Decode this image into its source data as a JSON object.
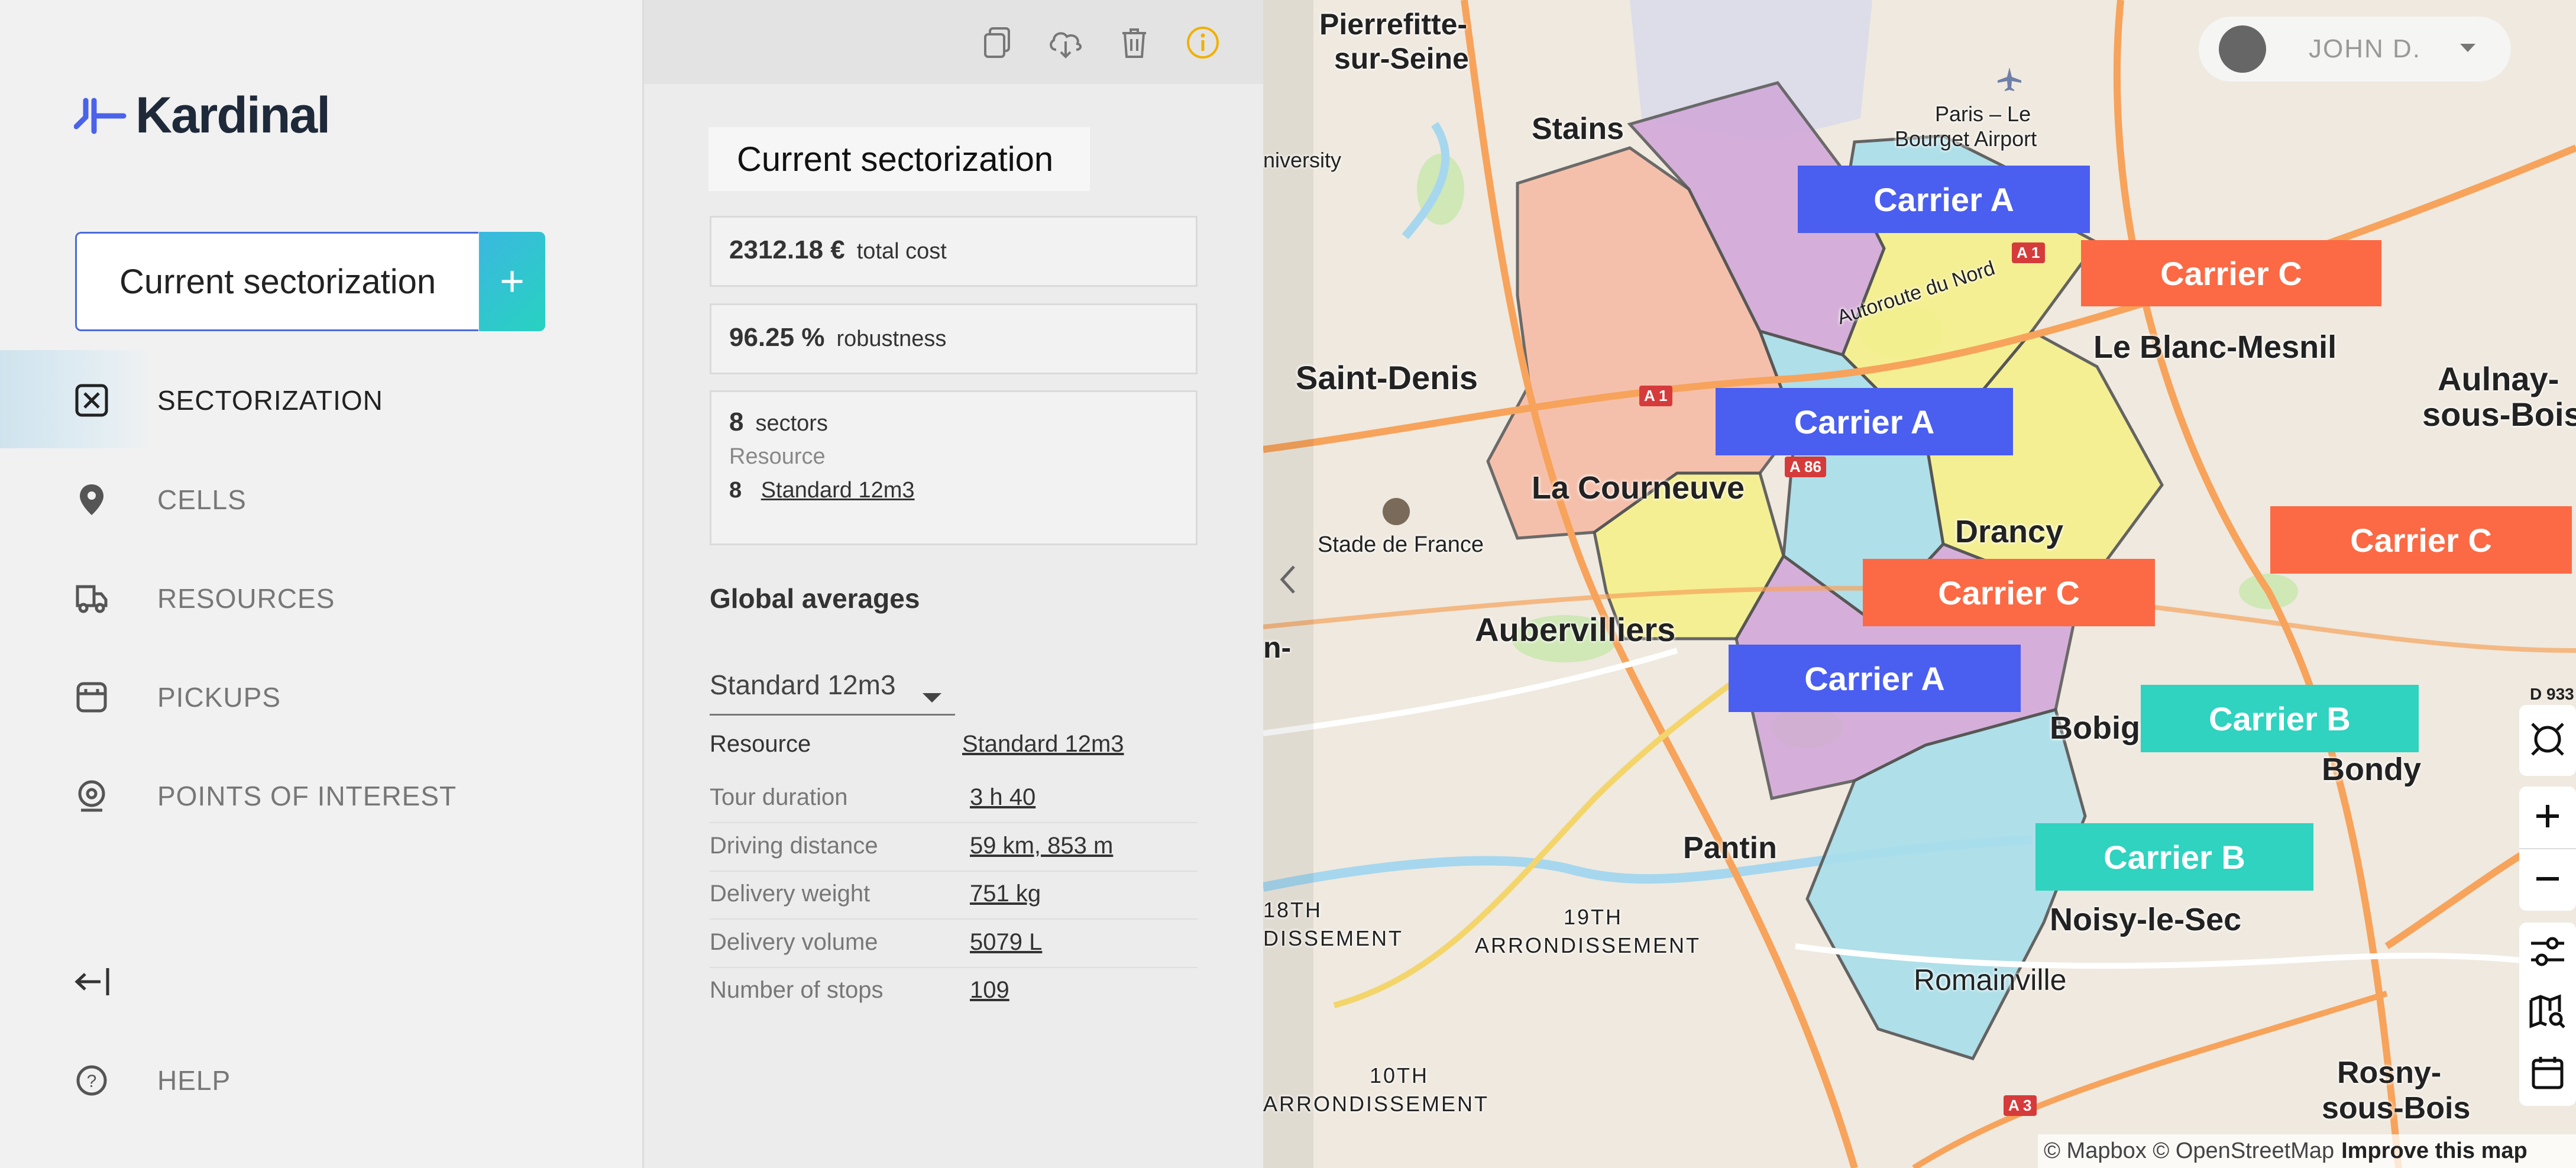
{
  "app": {
    "brand": "Kardinal"
  },
  "sidebar": {
    "sectorization_select": "Current sectorization",
    "add_label": "+",
    "items": [
      {
        "label": "SECTORIZATION",
        "icon": "sectorization-icon",
        "active": true
      },
      {
        "label": "CELLS",
        "icon": "location-pin-icon"
      },
      {
        "label": "RESOURCES",
        "icon": "truck-icon"
      },
      {
        "label": "PICKUPS",
        "icon": "pickup-box-icon"
      },
      {
        "label": "POINTS OF INTEREST",
        "icon": "poi-icon"
      }
    ],
    "collapse_icon": "collapse-left-icon",
    "help": "HELP"
  },
  "panel": {
    "toolbar": [
      "copy-icon",
      "cloud-download-icon",
      "trash-icon",
      "info-icon"
    ],
    "title": "Current sectorization",
    "total_cost_value": "2312.18 €",
    "total_cost_label": "total cost",
    "robustness_value": "96.25 %",
    "robustness_label": "robustness",
    "sectors_value": "8",
    "sectors_label": "sectors",
    "resource_heading": "Resource",
    "resource_count": "8",
    "resource_name": "Standard 12m3",
    "global_title": "Global averages",
    "global_select": "Standard 12m3",
    "rows": [
      {
        "k": "Resource",
        "v": "Standard 12m3"
      },
      {
        "k": "Tour duration",
        "v": "3 h 40"
      },
      {
        "k": "Driving distance",
        "v": "59 km, 853 m"
      },
      {
        "k": "Delivery weight",
        "v": "751 kg"
      },
      {
        "k": "Delivery volume",
        "v": "5079 L"
      },
      {
        "k": "Number of stops",
        "v": "109"
      }
    ]
  },
  "user": {
    "name": "JOHN D."
  },
  "map": {
    "carriers": [
      {
        "label": "Carrier A",
        "color": "#4a5ef0"
      },
      {
        "label": "Carrier C",
        "color": "#fb6a45"
      },
      {
        "label": "Carrier A",
        "color": "#4a5ef0"
      },
      {
        "label": "Carrier C",
        "color": "#fb6a45"
      },
      {
        "label": "Carrier C",
        "color": "#fb6a45"
      },
      {
        "label": "Carrier A",
        "color": "#4a5ef0"
      },
      {
        "label": "Carrier B",
        "color": "#2fd3bf"
      },
      {
        "label": "Carrier B",
        "color": "#2fd3bf"
      }
    ],
    "places": [
      "Pierrefitte-",
      "sur-Seine",
      "Stains",
      "Paris – Le",
      "Bourget Airport",
      "niversity",
      "Saint-Denis",
      "Le Blanc-Mesnil",
      "Aulnay-",
      "sous-Bois",
      "La Courneuve",
      "Stade de France",
      "Drancy",
      "Aubervilliers",
      "Bobigny",
      "Bondy",
      "Pantin",
      "Noisy-le-Sec",
      "Romainville",
      "Rosny-",
      "sous-Bois",
      "18TH",
      "DISSEMENT",
      "19TH",
      "ARRONDISSEMENT",
      "10TH",
      "ARRONDISSEMENT",
      "Autoroute du Nord",
      "n-"
    ],
    "road_shields": [
      "A 1",
      "A 1",
      "A 86",
      "A 3",
      "D 933"
    ],
    "attribution": "© Mapbox © OpenStreetMap",
    "improve": "Improve this map"
  }
}
